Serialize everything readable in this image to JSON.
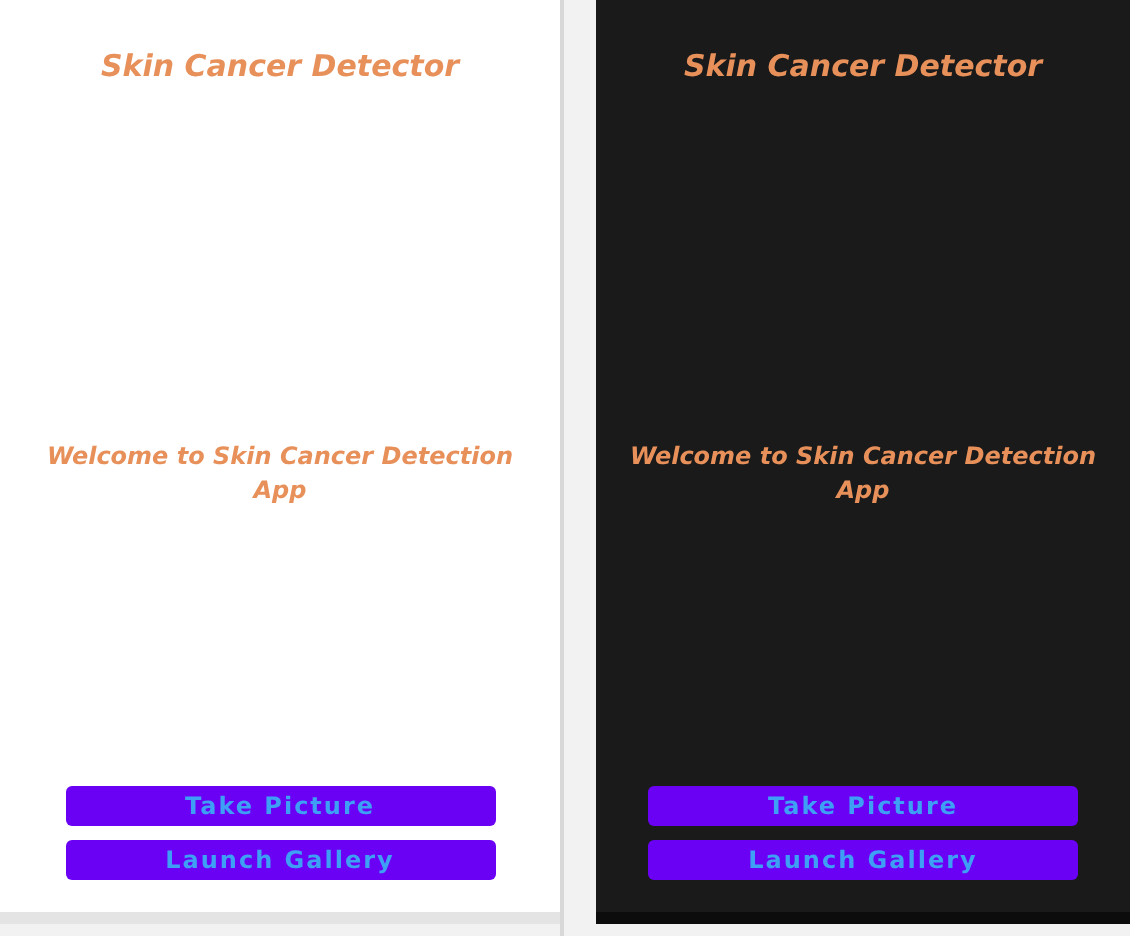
{
  "screens": [
    {
      "kind": "light",
      "title": "Skin Cancer Detector",
      "welcome": "Welcome to Skin Cancer Detection App",
      "buttons": [
        "Take Picture",
        "Launch Gallery"
      ]
    },
    {
      "kind": "dark",
      "title": "Skin Cancer Detector",
      "welcome": "Welcome to Skin Cancer Detection App",
      "buttons": [
        "Take Picture",
        "Launch Gallery"
      ]
    }
  ]
}
